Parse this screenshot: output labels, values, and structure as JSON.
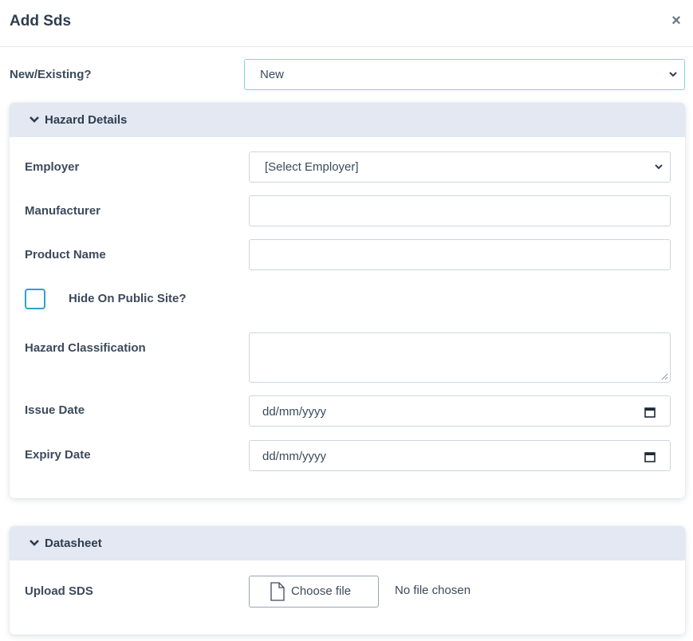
{
  "modal": {
    "title": "Add Sds",
    "close_label": "×"
  },
  "new_existing": {
    "label": "New/Existing?",
    "selected": "New"
  },
  "hazard_details": {
    "title": "Hazard Details",
    "employer": {
      "label": "Employer",
      "selected": "[Select Employer]"
    },
    "manufacturer": {
      "label": "Manufacturer",
      "value": ""
    },
    "product_name": {
      "label": "Product Name",
      "value": ""
    },
    "hide_public": {
      "label": "Hide On Public Site?",
      "checked": false
    },
    "hazard_classification": {
      "label": "Hazard Classification",
      "value": ""
    },
    "issue_date": {
      "label": "Issue Date",
      "placeholder": "dd/mm/yyyy"
    },
    "expiry_date": {
      "label": "Expiry Date",
      "placeholder": "dd/mm/yyyy"
    }
  },
  "datasheet": {
    "title": "Datasheet",
    "upload": {
      "label": "Upload SDS",
      "button": "Choose file",
      "status": "No file chosen"
    }
  },
  "colors": {
    "accent": "#2ea3c5",
    "section_header": "#e3e8f2",
    "select_border_focus": "#7fd3e0"
  }
}
